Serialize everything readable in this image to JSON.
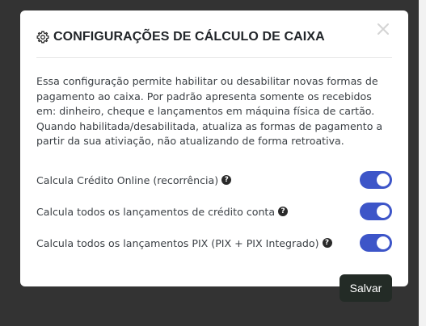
{
  "modal": {
    "title": "CONFIGURAÇÕES DE CÁLCULO DE CAIXA",
    "description": "Essa configuração permite habilitar ou desabilitar novas formas de pagamento ao caixa. Por padrão apresenta somente os recebidos em: dinheiro, cheque e lançamentos em máquina física de cartão. Quando habilitada/desabilitada, atualiza as formas de pagamento a partir da sua ativiação, não atualizando de forma retroativa.",
    "options": [
      {
        "label": "Calcula Crédito Online (recorrência)",
        "enabled": true
      },
      {
        "label": "Calcula todos os lançamentos de crédito conta",
        "enabled": true
      },
      {
        "label": "Calcula todos os lançamentos PIX (PIX + PIX Integrado)",
        "enabled": true
      }
    ],
    "help_glyph": "?",
    "icons": {
      "header": "gear-icon",
      "close": "close-icon",
      "help": "question-circle-icon"
    },
    "colors": {
      "toggle_on": "#3d55c8",
      "save_button": "#232b26",
      "overlay": "#333333"
    }
  },
  "footer": {
    "save_label": "Salvar"
  }
}
